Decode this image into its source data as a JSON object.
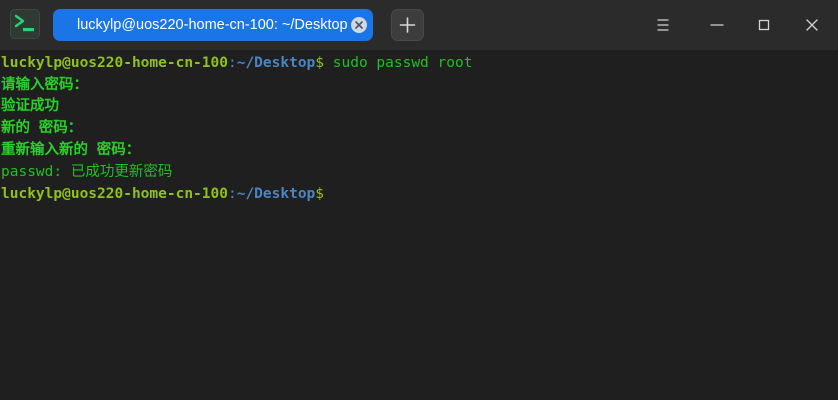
{
  "app": {
    "icon": "terminal-icon",
    "accent": "#1a75e6"
  },
  "tabs": [
    {
      "label": "luckylp@uos220-home-cn-100: ~/Desktop",
      "active": true
    }
  ],
  "window_controls": {
    "menu_icon": "hamburger-menu-icon",
    "minimize_icon": "minimize-icon",
    "maximize_icon": "maximize-icon",
    "close_icon": "close-icon",
    "new_tab_icon": "plus-icon"
  },
  "terminal": {
    "prompt": {
      "user_host": "luckylp@uos220-home-cn-100",
      "separator": ":",
      "path": "~/Desktop",
      "symbol": "$"
    },
    "lines": [
      {
        "kind": "prompt",
        "command": " sudo passwd root"
      },
      {
        "kind": "output",
        "text": "请输入密码："
      },
      {
        "kind": "output",
        "text": "验证成功"
      },
      {
        "kind": "output",
        "text": "新的 密码："
      },
      {
        "kind": "output",
        "text": "重新输入新的 密码："
      },
      {
        "kind": "output",
        "text": "passwd: 已成功更新密码"
      },
      {
        "kind": "prompt",
        "command": ""
      }
    ],
    "colors": {
      "background": "#1f1f1f",
      "user_host": "#8ec21f",
      "path": "#4a85c4",
      "output": "#20c020"
    }
  }
}
